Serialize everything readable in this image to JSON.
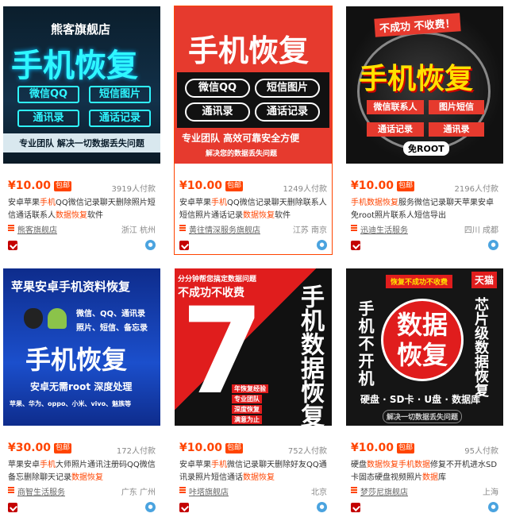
{
  "badge": "包邮",
  "products": [
    {
      "price": "¥10.00",
      "paid": "3919人付款",
      "desc_parts": [
        {
          "t": "安卓苹果",
          "h": false
        },
        {
          "t": "手机",
          "h": true
        },
        {
          "t": "QQ微信记录聊天删除照片短信通话联系人",
          "h": false
        },
        {
          "t": "数据恢复",
          "h": true
        },
        {
          "t": "软件",
          "h": false
        }
      ],
      "shop": "熊客旗舰店",
      "location": "浙江 杭州",
      "poster": {
        "top": "熊客旗舰店",
        "title": "手机恢复",
        "pills": [
          "微信QQ",
          "短信图片",
          "通讯录",
          "通话记录"
        ],
        "bottom": "专业团队 解决一切数据丢失问题"
      }
    },
    {
      "price": "¥10.00",
      "paid": "1249人付款",
      "desc_parts": [
        {
          "t": "安卓苹果",
          "h": false
        },
        {
          "t": "手机",
          "h": true
        },
        {
          "t": "QQ微信记录聊天删除联系人短信照片通话记录",
          "h": false
        },
        {
          "t": "数据恢复",
          "h": true
        },
        {
          "t": "软件",
          "h": false
        }
      ],
      "shop": "黄往情深服务旗舰店",
      "location": "江苏 南京",
      "poster": {
        "title": "手机恢复",
        "pills": [
          "微信QQ",
          "短信图片",
          "通讯录",
          "通话记录"
        ],
        "bottom": "专业团队 高效可靠安全方便",
        "sub": "解决您的数据丢失问题"
      }
    },
    {
      "price": "¥10.00",
      "paid": "2196人付款",
      "desc_parts": [
        {
          "t": "手机数据恢复",
          "h": true
        },
        {
          "t": "服务微信记录聊天苹果安卓免root照片联系人短信导出",
          "h": false
        }
      ],
      "shop": "迅迪生活服务",
      "location": "四川 成都",
      "poster": {
        "top": "不成功 不收费！",
        "title": "手机恢复",
        "pills": [
          "微信联系人",
          "图片短信",
          "通话记录",
          "通讯录"
        ],
        "bottom": "免ROOT"
      }
    },
    {
      "price": "¥30.00",
      "paid": "172人付款",
      "desc_parts": [
        {
          "t": "苹果安卓",
          "h": false
        },
        {
          "t": "手机",
          "h": true
        },
        {
          "t": "大师照片通讯注册码QQ微信备忘删除聊天记录",
          "h": false
        },
        {
          "t": "数据恢复",
          "h": true
        }
      ],
      "shop": "商智生活服务",
      "location": "广东 广州",
      "poster": {
        "top": "苹果安卓手机资料恢复",
        "list": [
          "微信、QQ、通讯录",
          "照片、短信、备忘录"
        ],
        "title": "手机恢复",
        "line1": "安卓无需root  深度处理",
        "line2": "苹果、华为、oppo、小米、vivo、魅族等"
      }
    },
    {
      "price": "¥10.00",
      "paid": "752人付款",
      "desc_parts": [
        {
          "t": "安卓苹果",
          "h": false
        },
        {
          "t": "手机",
          "h": true
        },
        {
          "t": "微信记录聊天删除好友QQ通讯录照片短信通话",
          "h": false
        },
        {
          "t": "数据恢复",
          "h": true
        }
      ],
      "shop": "咔塔旗舰店",
      "location": "北京",
      "poster": {
        "top1": "分分钟帮您搞定数据问题",
        "top2": "不成功不收费",
        "big": "7",
        "title": "手机数据恢复",
        "tags": [
          "年恢复经验",
          "专业团队",
          "深度恢复",
          "满意为止"
        ]
      }
    },
    {
      "price": "¥10.00",
      "paid": "95人付款",
      "desc_parts": [
        {
          "t": "硬盘",
          "h": false
        },
        {
          "t": "数据恢复手机数据",
          "h": true
        },
        {
          "t": "修复不开机进水SD卡固态硬盘视频照片",
          "h": false
        },
        {
          "t": "数据",
          "h": true
        },
        {
          "t": "库",
          "h": false
        }
      ],
      "shop": "梦莎尼旗舰店",
      "location": "上海",
      "poster": {
        "tag": "恢复不成功不收费",
        "tmall": "天猫",
        "left": "手机不开机",
        "circle": "数据恢复",
        "right": "芯片级数据恢复",
        "bottom": "硬盘 · SD卡 · U盘 · 数据库",
        "sub": "解决一切数据丢失问题"
      }
    }
  ]
}
